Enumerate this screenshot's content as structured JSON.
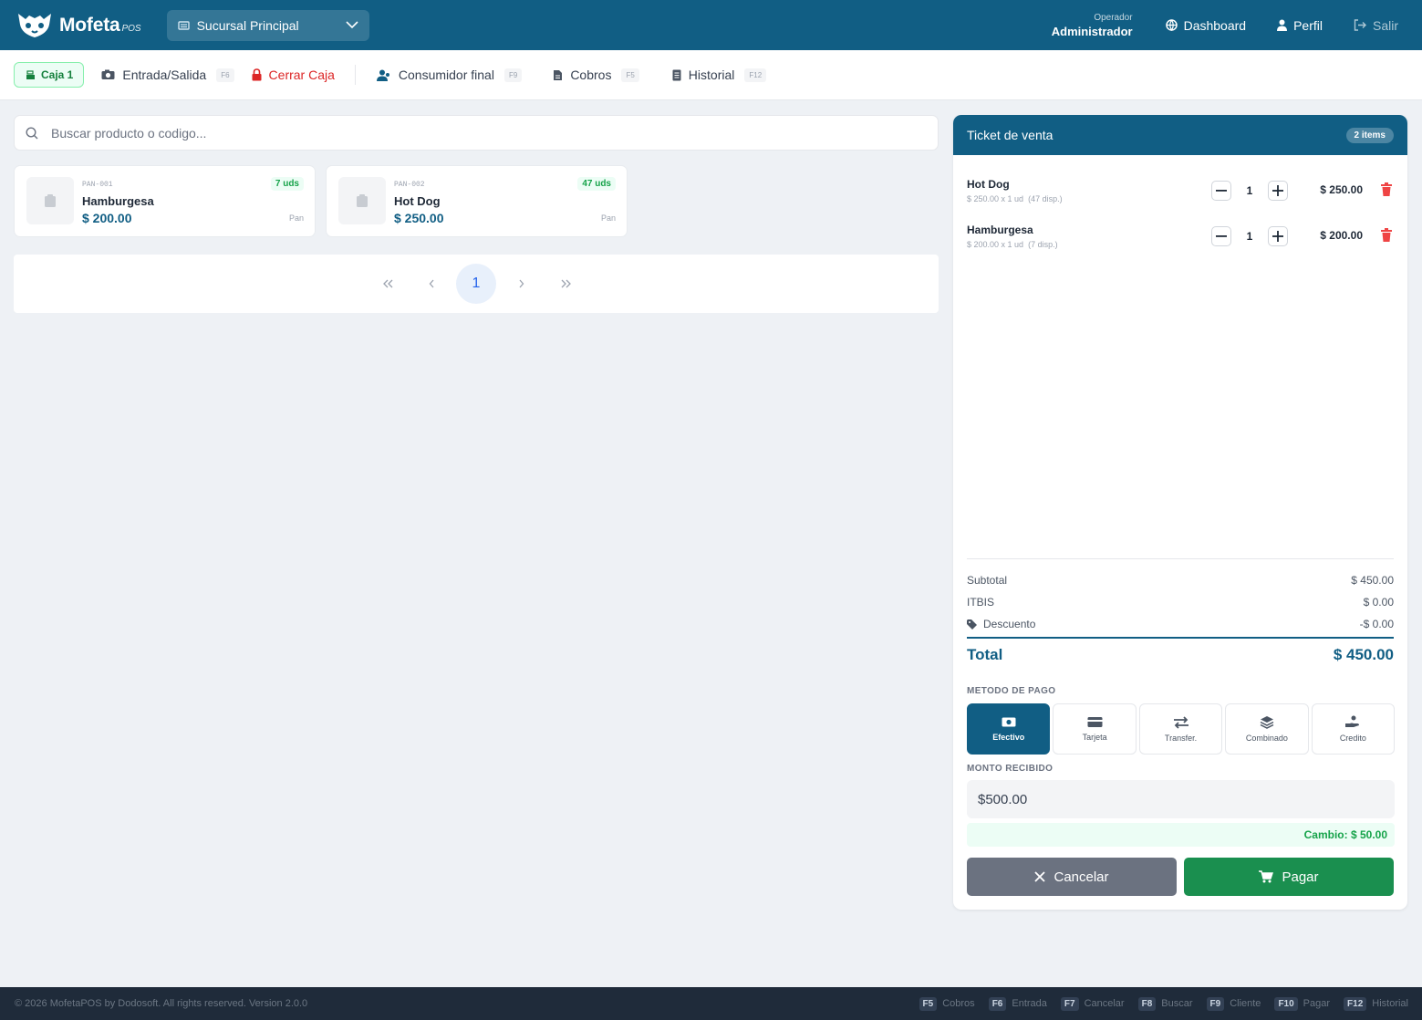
{
  "app": {
    "name": "Mofeta",
    "name_suffix": "POS"
  },
  "branch": {
    "selected": "Sucursal Principal"
  },
  "header": {
    "operator_label": "Operador",
    "operator_name": "Administrador",
    "nav": {
      "dashboard": "Dashboard",
      "profile": "Perfil",
      "logout": "Salir"
    }
  },
  "toolbar": {
    "register": "Caja 1",
    "cash_io": {
      "label": "Entrada/Salida",
      "key": "F6"
    },
    "close_register": "Cerrar Caja",
    "customer": {
      "label": "Consumidor final",
      "key": "F9"
    },
    "collections": {
      "label": "Cobros",
      "key": "F5"
    },
    "history": {
      "label": "Historial",
      "key": "F12"
    }
  },
  "search": {
    "placeholder": "Buscar producto o codigo..."
  },
  "products": [
    {
      "sku": "PAN-001",
      "name": "Hamburgesa",
      "price": "$ 200.00",
      "stock": "7 uds",
      "category": "Pan"
    },
    {
      "sku": "PAN-002",
      "name": "Hot Dog",
      "price": "$ 250.00",
      "stock": "47 uds",
      "category": "Pan"
    }
  ],
  "pagination": {
    "current_page": "1"
  },
  "ticket": {
    "title": "Ticket de venta",
    "count": "2 items",
    "lines": [
      {
        "name": "Hot Dog",
        "detail": "$ 250.00 x 1 ud",
        "available": "(47 disp.)",
        "qty": "1",
        "total": "$ 250.00"
      },
      {
        "name": "Hamburgesa",
        "detail": "$ 200.00 x 1 ud",
        "available": "(7 disp.)",
        "qty": "1",
        "total": "$ 200.00"
      }
    ],
    "subtotal_label": "Subtotal",
    "subtotal": "$ 450.00",
    "tax_label": "ITBIS",
    "tax": "$ 0.00",
    "discount_label": "Descuento",
    "discount": "-$ 0.00",
    "total_label": "Total",
    "total": "$ 450.00",
    "payment_label": "METODO DE PAGO",
    "payment_methods": [
      "Efectivo",
      "Tarjeta",
      "Transfer.",
      "Combinado",
      "Credito"
    ],
    "selected_method": "Efectivo",
    "received_label": "MONTO RECIBIDO",
    "received_value": "$500.00",
    "change": "Cambio: $ 50.00",
    "cancel": "Cancelar",
    "pay": "Pagar"
  },
  "footer": {
    "copyright": "© 2026 MofetaPOS by Dodosoft. All rights reserved. Version 2.0.0",
    "shortcuts": [
      {
        "key": "F5",
        "label": "Cobros"
      },
      {
        "key": "F6",
        "label": "Entrada"
      },
      {
        "key": "F7",
        "label": "Cancelar"
      },
      {
        "key": "F8",
        "label": "Buscar"
      },
      {
        "key": "F9",
        "label": "Cliente"
      },
      {
        "key": "F10",
        "label": "Pagar"
      },
      {
        "key": "F12",
        "label": "Historial"
      }
    ]
  },
  "colors": {
    "primary": "#115e84",
    "success": "#1a8f4f",
    "danger": "#dc2626",
    "footer": "#1f2b3a"
  },
  "icons": [
    "logo-icon",
    "building-icon",
    "chevron-down-icon",
    "globe-icon",
    "user-icon",
    "logout-icon",
    "register-icon",
    "camera-icon",
    "lock-icon",
    "users-icon",
    "receipt-icon",
    "list-icon",
    "search-icon",
    "box-icon",
    "minus-icon",
    "plus-icon",
    "trash-icon",
    "tag-icon",
    "cash-icon",
    "card-icon",
    "transfer-icon",
    "layers-icon",
    "hand-icon",
    "close-icon",
    "cart-icon"
  ]
}
